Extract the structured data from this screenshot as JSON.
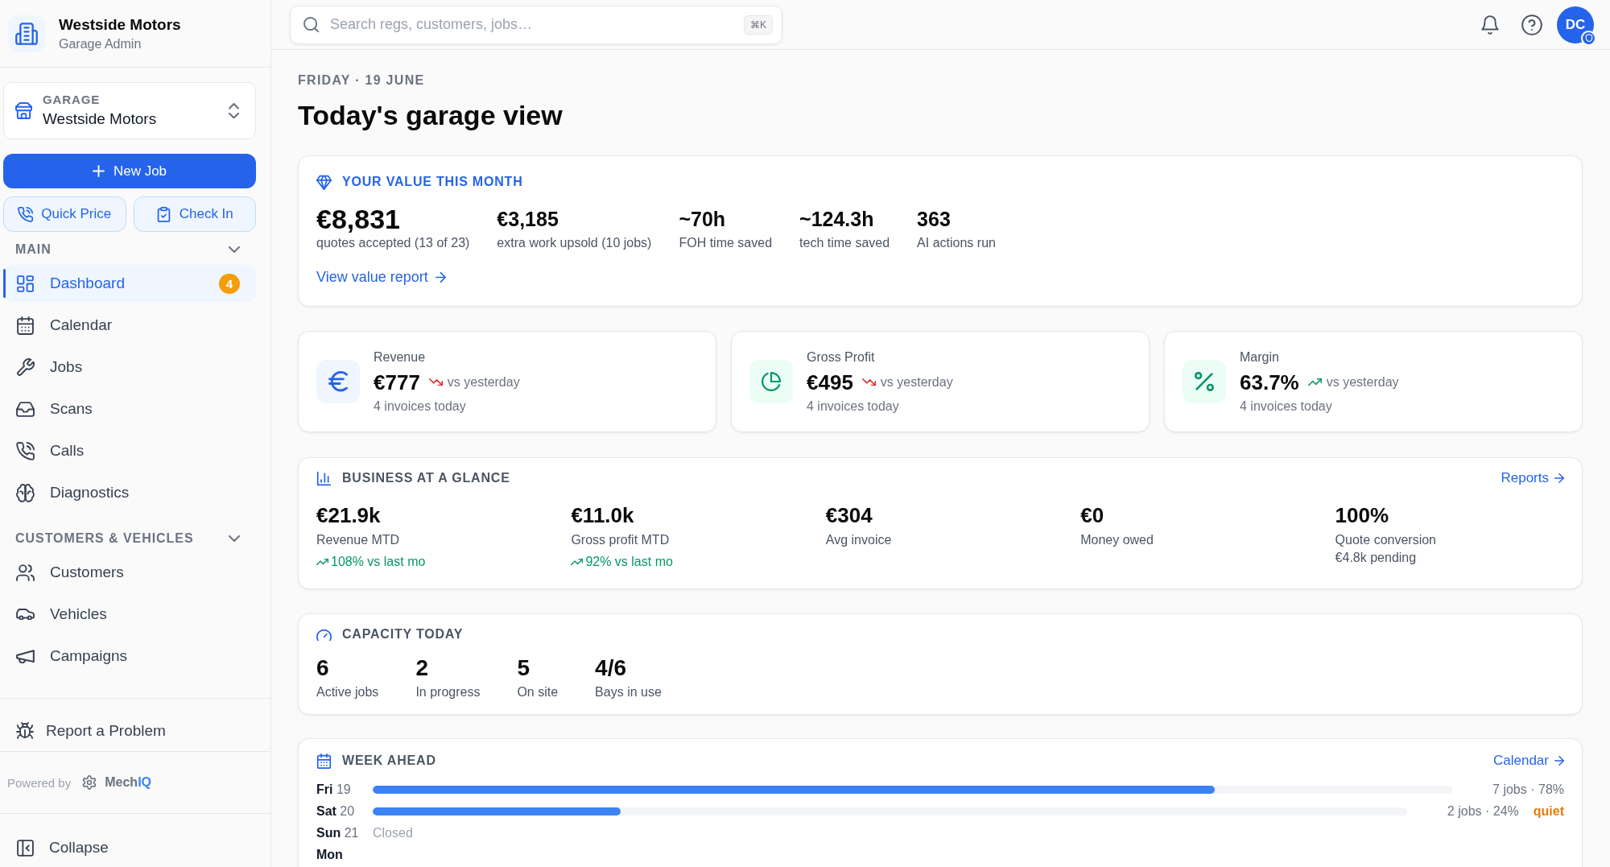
{
  "sidebar": {
    "brand": {
      "title": "Westside Motors",
      "subtitle": "Garage Admin"
    },
    "garage_selector": {
      "label": "GARAGE",
      "value": "Westside Motors"
    },
    "new_job_button": {
      "label": "New Job"
    },
    "quick_actions": [
      {
        "label": "Quick Price"
      },
      {
        "label": "Check In"
      }
    ],
    "sections": [
      {
        "title": "MAIN",
        "expanded": true,
        "items": [
          {
            "label": "Dashboard",
            "selected": true,
            "badge": "4"
          },
          {
            "label": "Calendar",
            "selected": false
          },
          {
            "label": "Jobs",
            "selected": false
          },
          {
            "label": "Scans",
            "selected": false
          },
          {
            "label": "Calls",
            "selected": false
          },
          {
            "label": "Diagnostics",
            "selected": false
          }
        ]
      },
      {
        "title": "CUSTOMERS & VEHICLES",
        "expanded": true,
        "items": [
          {
            "label": "Customers",
            "selected": false
          },
          {
            "label": "Vehicles",
            "selected": false
          },
          {
            "label": "Campaigns",
            "selected": false
          }
        ]
      }
    ],
    "report_problem": {
      "label": "Report a Problem"
    },
    "powered_by": {
      "text": "Powered by",
      "brand_prefix": "Mech",
      "brand_suffix": "IQ"
    },
    "collapse": {
      "label": "Collapse"
    }
  },
  "top_bar": {
    "search": {
      "placeholder": "Search regs, customers, jobs…",
      "shortcut": "⌘K"
    },
    "avatar": {
      "initials": "DC"
    }
  },
  "page_header": {
    "date": "FRIDAY · 19 JUNE",
    "title": "Today's garage view"
  },
  "value_card": {
    "title": "YOUR VALUE THIS MONTH",
    "metrics": [
      {
        "kind": "hero",
        "value": "€8,831",
        "label": "quotes accepted (13 of 23)"
      },
      {
        "kind": "stat",
        "value": "€3,185",
        "label": "extra work upsold (10 jobs)"
      },
      {
        "kind": "stat",
        "value": "~70h",
        "label": "FOH time saved"
      },
      {
        "kind": "stat",
        "value": "~124.3h",
        "label": "tech time saved"
      },
      {
        "kind": "stat",
        "value": "363",
        "label": "AI actions run"
      }
    ],
    "link": "View value report"
  },
  "kpi_cards": [
    {
      "label": "Revenue",
      "value": "€777",
      "trend_up": false,
      "comparison": "vs yesterday",
      "note": "4 invoices today"
    },
    {
      "label": "Gross Profit",
      "value": "€495",
      "trend_up": false,
      "comparison": "vs yesterday",
      "note": "4 invoices today"
    },
    {
      "label": "Margin",
      "value": "63.7%",
      "trend_up": true,
      "comparison": "vs yesterday",
      "note": "4 invoices today"
    }
  ],
  "business_at_a_glance": {
    "title": "BUSINESS AT A GLANCE",
    "link": "Reports",
    "metrics": [
      {
        "value": "€21.9k",
        "label": "Revenue MTD",
        "change": {
          "trend_up": true,
          "text": "108% vs last mo"
        }
      },
      {
        "value": "€11.0k",
        "label": "Gross profit MTD",
        "change": {
          "trend_up": true,
          "text": "92% vs last mo"
        }
      },
      {
        "value": "€304",
        "label": "Avg invoice"
      },
      {
        "value": "€0",
        "label": "Money owed"
      },
      {
        "value": "100%",
        "label": "Quote conversion",
        "note": "€4.8k pending"
      }
    ]
  },
  "capacity_today": {
    "title": "CAPACITY TODAY",
    "metrics": [
      {
        "value": "6",
        "label": "Active jobs"
      },
      {
        "value": "2",
        "label": "In progress"
      },
      {
        "value": "5",
        "label": "On site"
      },
      {
        "value": "4/6",
        "label": "Bays in use"
      }
    ]
  },
  "week_ahead": {
    "title": "WEEK AHEAD",
    "link": "Calendar",
    "days": [
      {
        "kind": "open",
        "day": "Fri",
        "date": "19",
        "level": 0.78,
        "summary": "7 jobs · 78%"
      },
      {
        "kind": "open",
        "day": "Sat",
        "date": "20",
        "level": 0.24,
        "summary": "2 jobs · 24%",
        "tag": "quiet"
      },
      {
        "kind": "closed",
        "day": "Sun",
        "date": "21",
        "status": "Closed"
      },
      {
        "day": "Mon"
      }
    ]
  }
}
